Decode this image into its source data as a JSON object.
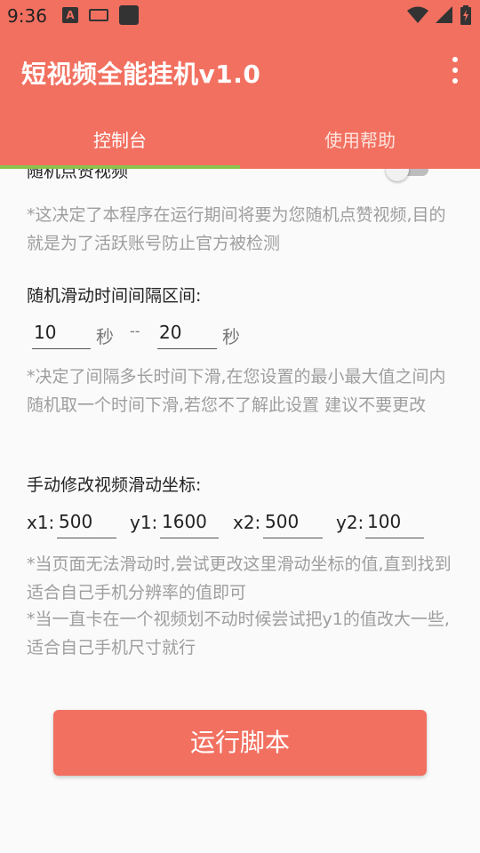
{
  "status_bar": {
    "time": "9:36",
    "icons": [
      "a-icon",
      "keyboard-icon",
      "app-icon",
      "wifi-icon",
      "signal-icon",
      "battery-icon"
    ]
  },
  "app_bar": {
    "title": "短视频全能挂机v1.0",
    "menu_icon": "more-vert-icon",
    "color": "#f27060"
  },
  "tabs": [
    {
      "label": "控制台",
      "selected": true
    },
    {
      "label": "使用帮助",
      "selected": false
    }
  ],
  "tab_indicator_color": "#8bc34a",
  "random_like": {
    "label": "随机点赞视频",
    "enabled": false,
    "hint": "*这决定了本程序在运行期间将要为您随机点赞视频,目的就是为了活跃账号防止官方被检测"
  },
  "swipe_interval": {
    "label": "随机滑动时间间隔区间:",
    "min_value": "10",
    "max_value": "20",
    "unit": "秒",
    "separator": "--",
    "hint": "*决定了间隔多长时间下滑,在您设置的最小最大值之间内随机取一个时间下滑,若您不了解此设置 建议不要更改"
  },
  "swipe_coords": {
    "label": "手动修改视频滑动坐标:",
    "x1_label": "x1:",
    "x1_value": "500",
    "y1_label": "y1:",
    "y1_value": "1600",
    "x2_label": "x2:",
    "x2_value": "500",
    "y2_label": "y2:",
    "y2_value": "100",
    "hint1": "*当页面无法滑动时,尝试更改这里滑动坐标的值,直到找到适合自己手机分辨率的值即可",
    "hint2": "*当一直卡在一个视频划不动时候尝试把y1的值改大一些,适合自己手机尺寸就行"
  },
  "run_button": {
    "label": "运行脚本"
  }
}
